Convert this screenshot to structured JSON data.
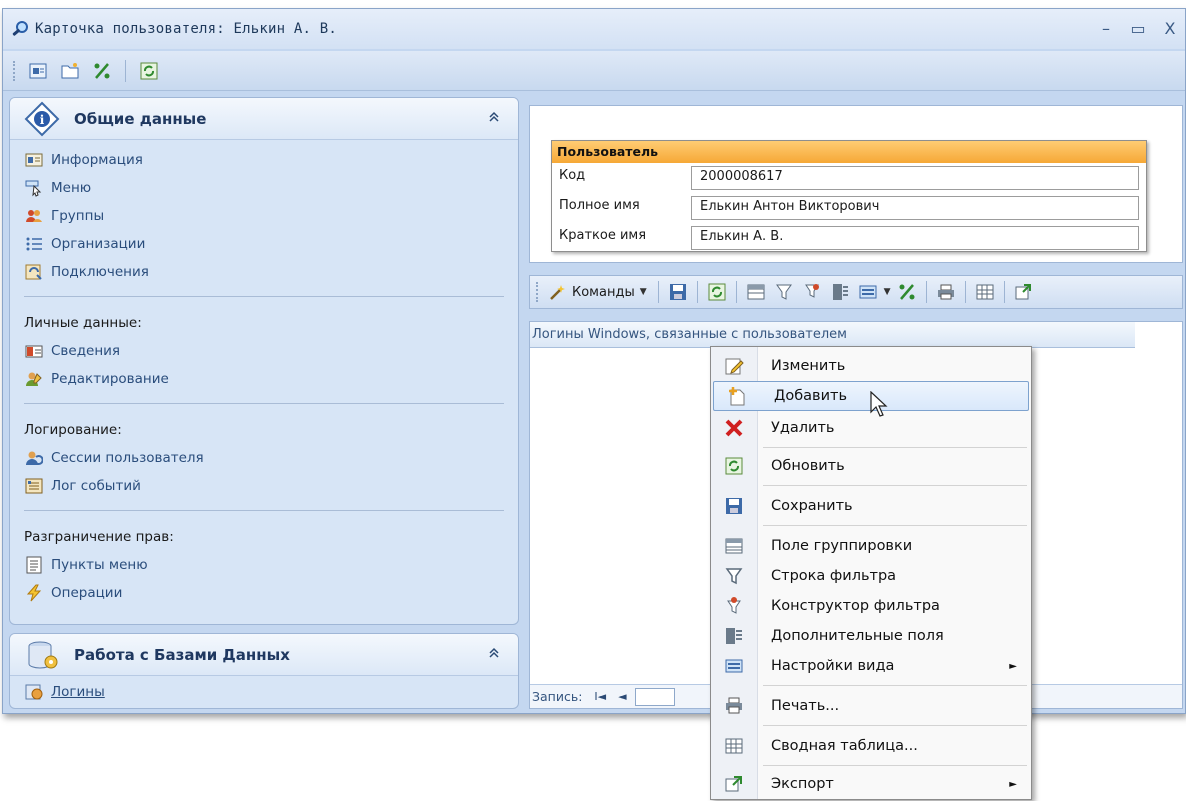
{
  "window": {
    "title": "Карточка пользователя: Елькин А. В.",
    "controls": {
      "minimize": "–",
      "maximize": "▭",
      "close": "X"
    }
  },
  "toolbar": {
    "icons": [
      "card-icon",
      "folder-icon",
      "percent-icon",
      "refresh-icon"
    ]
  },
  "sidebar": {
    "general": {
      "title": "Общие данные",
      "collapse": "«",
      "items": [
        {
          "label": "Информация",
          "icon": "info-card-icon"
        },
        {
          "label": "Меню",
          "icon": "menu-cursor-icon"
        },
        {
          "label": "Группы",
          "icon": "group-users-icon"
        },
        {
          "label": "Организации",
          "icon": "list-icon"
        },
        {
          "label": "Подключения",
          "icon": "connection-icon"
        }
      ],
      "sections": [
        {
          "label": "Личные данные:",
          "items": [
            {
              "label": "Сведения",
              "icon": "id-card-icon"
            },
            {
              "label": "Редактирование",
              "icon": "user-edit-icon"
            }
          ]
        },
        {
          "label": "Логирование:",
          "items": [
            {
              "label": "Сессии пользователя",
              "icon": "session-icon"
            },
            {
              "label": "Лог событий",
              "icon": "event-log-icon"
            }
          ]
        },
        {
          "label": "Разграничение прав:",
          "items": [
            {
              "label": "Пункты меню",
              "icon": "document-icon"
            },
            {
              "label": "Операции",
              "icon": "lightning-icon"
            }
          ]
        }
      ]
    },
    "databases": {
      "title": "Работа с Базами Данных",
      "collapse": "«",
      "items": [
        {
          "label": "Логины",
          "icon": "login-icon"
        }
      ]
    }
  },
  "user_card": {
    "header": "Пользователь",
    "fields": [
      {
        "label": "Код",
        "value": "2000008617"
      },
      {
        "label": "Полное имя",
        "value": "Елькин Антон Викторович"
      },
      {
        "label": "Краткое имя",
        "value": "Елькин А. В."
      }
    ]
  },
  "grid_toolbar": {
    "commands_label": "Команды"
  },
  "grid": {
    "header": "Логины Windows, связанные с пользователем",
    "nav_label": "Запись:",
    "nav_first": "I◄",
    "nav_prev": "◄"
  },
  "context_menu": {
    "items": [
      {
        "label": "Изменить",
        "icon": "edit-icon"
      },
      {
        "label": "Добавить",
        "icon": "add-icon",
        "highlighted": true
      },
      {
        "label": "Удалить",
        "icon": "delete-icon"
      },
      {
        "label": "Обновить",
        "icon": "refresh-icon"
      },
      {
        "label": "Сохранить",
        "icon": "save-icon"
      },
      {
        "label": "Поле группировки",
        "icon": "group-field-icon"
      },
      {
        "label": "Строка фильтра",
        "icon": "filter-icon"
      },
      {
        "label": "Конструктор фильтра",
        "icon": "filter-builder-icon"
      },
      {
        "label": "Дополнительные поля",
        "icon": "extra-fields-icon"
      },
      {
        "label": "Настройки вида",
        "icon": "view-settings-icon",
        "submenu": true
      },
      {
        "label": "Печать...",
        "icon": "print-icon"
      },
      {
        "label": "Сводная таблица...",
        "icon": "pivot-table-icon"
      },
      {
        "label": "Экспорт",
        "icon": "export-icon",
        "submenu": true
      }
    ],
    "submenu_arrow": "►"
  },
  "colors": {
    "window_bg": "#c4d7f0",
    "header_orange": "#f6a836",
    "link_blue": "#2a4d7c",
    "highlight": "#d9e8fb"
  }
}
